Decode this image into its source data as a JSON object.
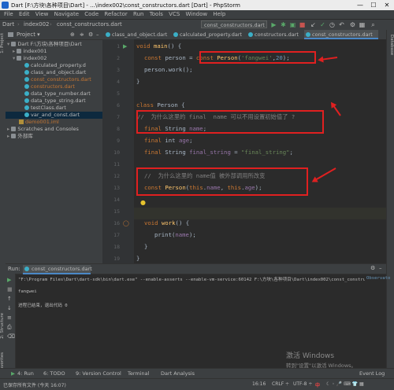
{
  "window": {
    "title": "Dart [F:\\方块\\各种项目\\Dart] - ...\\index002\\const_constructors.dart [Dart] - PhpStorm",
    "minimize": "—",
    "maximize": "☐",
    "close": "✕"
  },
  "menu": [
    "File",
    "Edit",
    "View",
    "Navigate",
    "Code",
    "Refactor",
    "Run",
    "Tools",
    "VCS",
    "Window",
    "Help"
  ],
  "breadcrumbs": [
    "Dart",
    "index002",
    "const_constructors.dart"
  ],
  "run_config": "const_constructors.dart ▾",
  "project_panel": {
    "title": "Project ▾",
    "items": [
      {
        "label": "Dart  F:\\方块\\各种项目\\Dart",
        "type": "folder"
      },
      {
        "label": "index001",
        "type": "folder"
      },
      {
        "label": "index002",
        "type": "folder"
      },
      {
        "label": "calculated_property.d",
        "type": "dart"
      },
      {
        "label": "class_and_object.dart",
        "type": "dart"
      },
      {
        "label": "const_constructors.dart",
        "type": "dart"
      },
      {
        "label": "constructors.dart",
        "type": "dart"
      },
      {
        "label": "data_type_number.dart",
        "type": "dart"
      },
      {
        "label": "data_type_string.dart",
        "type": "dart"
      },
      {
        "label": "testClass.dart",
        "type": "dart"
      },
      {
        "label": "var_and_const.dart",
        "type": "dart"
      },
      {
        "label": "demo001.iml",
        "type": "file"
      },
      {
        "label": "Scratches and Consoles",
        "type": "folder"
      },
      {
        "label": "外部库",
        "type": "folder"
      }
    ]
  },
  "editor_tabs": [
    {
      "label": "class_and_object.dart",
      "active": false
    },
    {
      "label": "calculated_property.dart",
      "active": false
    },
    {
      "label": "constructors.dart",
      "active": false
    },
    {
      "label": "const_constructors.dart",
      "active": true
    }
  ],
  "line_numbers": [
    "1",
    "2",
    "3",
    "4",
    "5",
    "6",
    "7",
    "8",
    "9",
    "10",
    "11",
    "12",
    "13",
    "14",
    "15",
    "16",
    "17",
    "18",
    "19"
  ],
  "code": {
    "l1_kw": "void",
    "l1_fn": " main",
    "l1_rest": "() {",
    "l2_kw": "const",
    "l2_mid": " person = ",
    "l2_kw2": "const",
    "l2_fn": " Person",
    "l2_p": "(",
    "l2_str": "'fangwei'",
    "l2_c": ",",
    "l2_num": "20",
    "l2_e": ");",
    "l3": "person.work();",
    "l4": "}",
    "l6_kw": "class",
    "l6_rest": " Person {",
    "l7_cm": "//  为什么这里的 final  name 可以不用设置初始值了 ?",
    "l8_kw": "final",
    "l8_type": " String ",
    "l8_fld": "name",
    "l8_e": ";",
    "l9_kw": "final",
    "l9_type": " int ",
    "l9_fld": "age",
    "l9_e": ";",
    "l10_kw": "final",
    "l10_type": " String ",
    "l10_fld": "final_string",
    "l10_mid": " = ",
    "l10_str": "\"final_string\"",
    "l10_e": ";",
    "l12_cm": "//  为什么这里的 name值 被外部调用所改变",
    "l13_kw": "const",
    "l13_fn": " Person",
    "l13_p": "(",
    "l13_kw2": "this",
    "l13_d": ".",
    "l13_fld": "name",
    "l13_c": ", ",
    "l13_kw3": "this",
    "l13_d2": ".",
    "l13_fld2": "age",
    "l13_e": ");",
    "l16_kw": "void",
    "l16_fn": " work",
    "l16_rest": "() {",
    "l17_a": "print(",
    "l17_fld": "name",
    "l17_b": ");",
    "l18": "}",
    "l19": "}"
  },
  "run_panel": {
    "label": "Run:",
    "tab": "const_constructors.dart",
    "cmd": "\"F:\\Program Files\\Dart\\dart-sdk\\bin\\dart.exe\" --enable-asserts --enable-vm-service:60142 F:\\方块\\各种项目\\Dart\\index002\\const_constructors.dart",
    "observatory": "Observato",
    "output": "fangwei",
    "exit": "进程已结束，退出代码 0"
  },
  "left_strip": {
    "project": "1: Project",
    "structure": "2: Structure",
    "favorites": "2: Favorites"
  },
  "right_strip": {
    "database": "Database"
  },
  "bottom_tabs": [
    "4: Run",
    "6: TODO",
    "9: Version Control",
    "Terminal",
    "Dart Analysis"
  ],
  "event_log": "Event Log",
  "status": {
    "message": "已保存所有文件 (今天 16:07)",
    "position": "16:16",
    "line_sep": "CRLF ÷",
    "encoding": "UTF-8 ÷",
    "ime": "中"
  },
  "watermark": {
    "line1": "激活 Windows",
    "line2": "转到\"设置\"以激活 Windows。"
  }
}
